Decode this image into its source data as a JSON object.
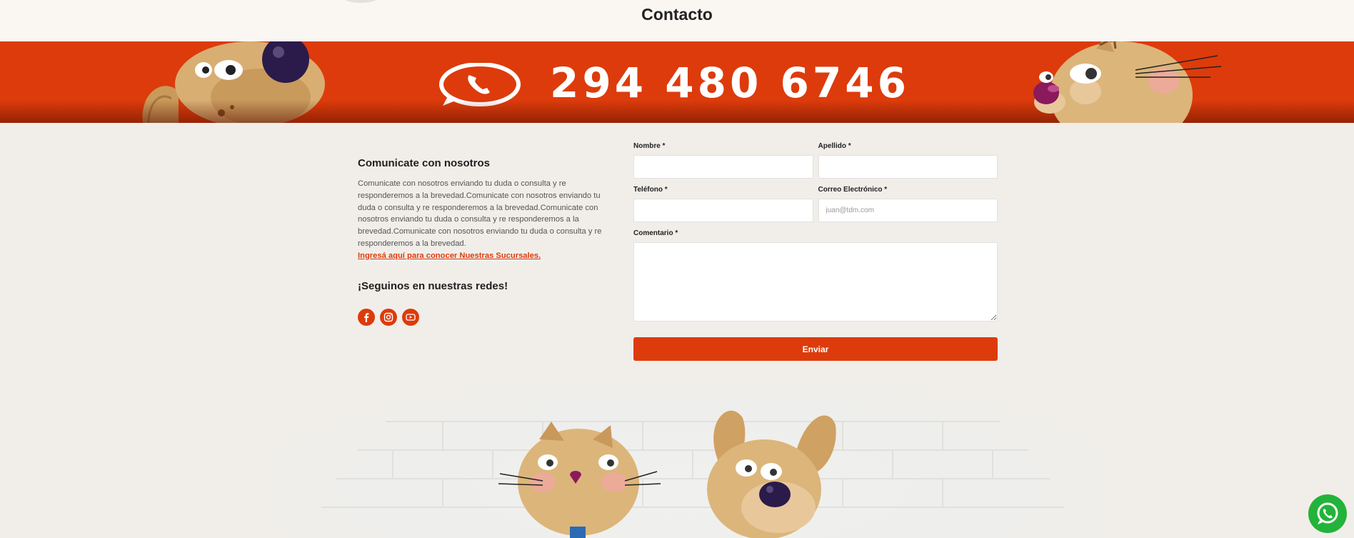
{
  "header": {
    "title": "Contacto"
  },
  "banner": {
    "phone": "294 480 6746"
  },
  "contact_info": {
    "heading": "Comunicate con nosotros",
    "description": "Comunicate con nosotros enviando tu duda o consulta y re responderemos a la brevedad.Comunicate con nosotros enviando tu duda o consulta y re responderemos a la brevedad.Comunicate con nosotros enviando tu duda o consulta y re responderemos a la brevedad.Comunicate con nosotros enviando tu duda o consulta y re responderemos a la brevedad.",
    "branches_link": "Ingresá aquí para conocer Nuestras Sucursales.",
    "social_heading": "¡Seguinos en nuestras redes!",
    "social_icons": [
      "facebook-icon",
      "instagram-icon",
      "youtube-icon"
    ]
  },
  "form": {
    "first_name_label": "Nombre *",
    "last_name_label": "Apellido *",
    "phone_label": "Teléfono *",
    "email_label": "Correo Electrónico *",
    "email_placeholder": "juan@tdm.com",
    "comment_label": "Comentario *",
    "submit_label": "Enviar"
  },
  "colors": {
    "accent": "#dd3b0b",
    "whatsapp": "#23b33a",
    "page_bg": "#f1eee9"
  }
}
